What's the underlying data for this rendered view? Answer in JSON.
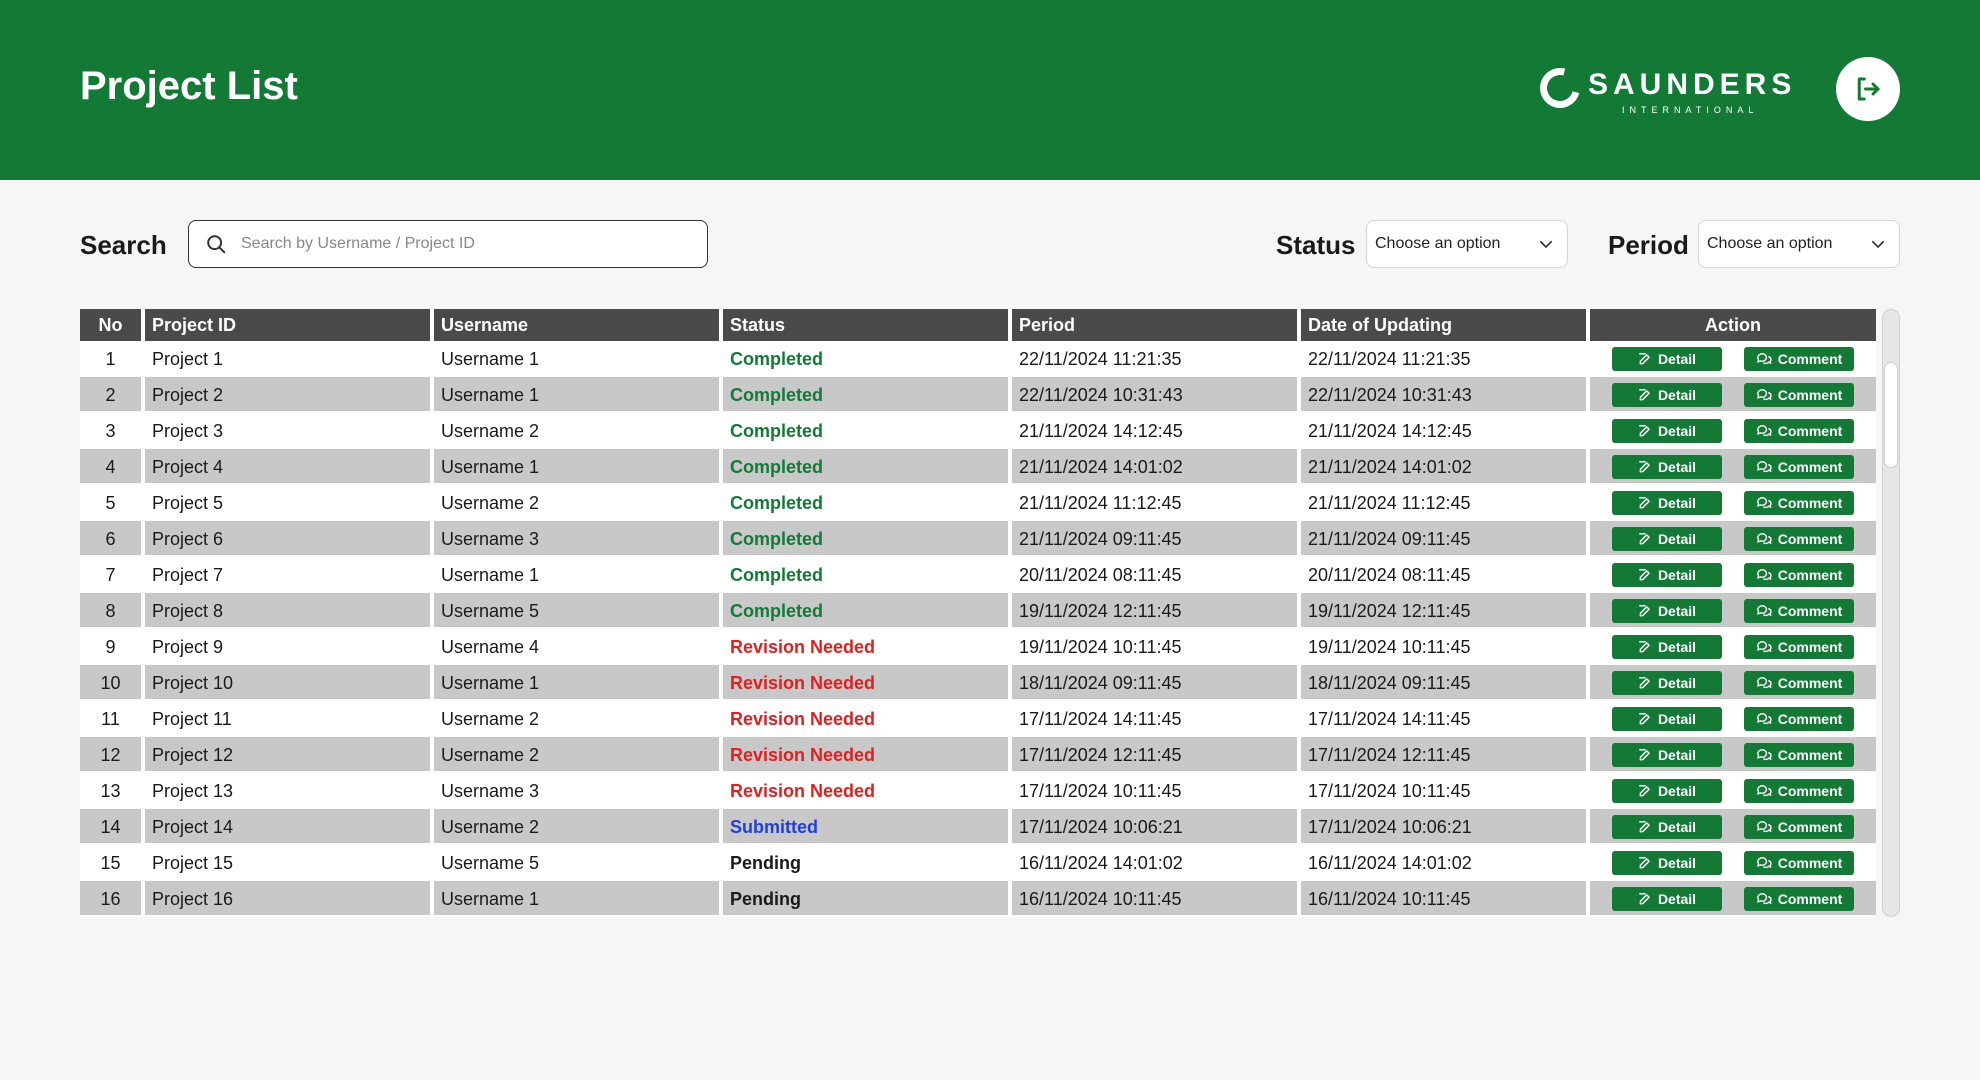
{
  "header": {
    "title": "Project List",
    "brand": "SAUNDERS",
    "brand_sub": "INTERNATIONAL",
    "logout_icon": "logout-icon",
    "color": "#137a36"
  },
  "filters": {
    "search_label": "Search",
    "search_placeholder": "Search by Username / Project ID",
    "search_value": "",
    "status_label": "Status",
    "status_value": "Choose an option",
    "period_label": "Period",
    "period_value": "Choose an option"
  },
  "table": {
    "columns": [
      "No",
      "Project ID",
      "Username",
      "Status",
      "Period",
      "Date of Updating",
      "Action"
    ],
    "detail_label": "Detail",
    "comment_label": "Comment",
    "rows": [
      {
        "no": "1",
        "project": "Project 1",
        "user": "Username 1",
        "status": "Completed",
        "period": "22/11/2024 11:21:35",
        "updated": "22/11/2024 11:21:35"
      },
      {
        "no": "2",
        "project": "Project 2",
        "user": "Username 1",
        "status": "Completed",
        "period": "22/11/2024 10:31:43",
        "updated": "22/11/2024 10:31:43"
      },
      {
        "no": "3",
        "project": "Project 3",
        "user": "Username 2",
        "status": "Completed",
        "period": "21/11/2024 14:12:45",
        "updated": "21/11/2024 14:12:45"
      },
      {
        "no": "4",
        "project": "Project 4",
        "user": "Username 1",
        "status": "Completed",
        "period": "21/11/2024 14:01:02",
        "updated": "21/11/2024 14:01:02"
      },
      {
        "no": "5",
        "project": "Project 5",
        "user": "Username 2",
        "status": "Completed",
        "period": "21/11/2024 11:12:45",
        "updated": "21/11/2024 11:12:45"
      },
      {
        "no": "6",
        "project": "Project 6",
        "user": "Username 3",
        "status": "Completed",
        "period": "21/11/2024 09:11:45",
        "updated": "21/11/2024 09:11:45"
      },
      {
        "no": "7",
        "project": "Project 7",
        "user": "Username 1",
        "status": "Completed",
        "period": "20/11/2024 08:11:45",
        "updated": "20/11/2024 08:11:45"
      },
      {
        "no": "8",
        "project": "Project 8",
        "user": "Username 5",
        "status": "Completed",
        "period": "19/11/2024 12:11:45",
        "updated": "19/11/2024 12:11:45"
      },
      {
        "no": "9",
        "project": "Project 9",
        "user": "Username 4",
        "status": "Revision Needed",
        "period": "19/11/2024 10:11:45",
        "updated": "19/11/2024 10:11:45"
      },
      {
        "no": "10",
        "project": "Project 10",
        "user": "Username 1",
        "status": "Revision Needed",
        "period": "18/11/2024 09:11:45",
        "updated": "18/11/2024 09:11:45"
      },
      {
        "no": "11",
        "project": "Project 11",
        "user": "Username 2",
        "status": "Revision Needed",
        "period": "17/11/2024 14:11:45",
        "updated": "17/11/2024 14:11:45"
      },
      {
        "no": "12",
        "project": "Project 12",
        "user": "Username 2",
        "status": "Revision Needed",
        "period": "17/11/2024 12:11:45",
        "updated": "17/11/2024 12:11:45"
      },
      {
        "no": "13",
        "project": "Project 13",
        "user": "Username 3",
        "status": "Revision Needed",
        "period": "17/11/2024 10:11:45",
        "updated": "17/11/2024 10:11:45"
      },
      {
        "no": "14",
        "project": "Project 14",
        "user": "Username 2",
        "status": "Submitted",
        "period": "17/11/2024 10:06:21",
        "updated": "17/11/2024 10:06:21"
      },
      {
        "no": "15",
        "project": "Project 15",
        "user": "Username 5",
        "status": "Pending",
        "period": "16/11/2024 14:01:02",
        "updated": "16/11/2024 14:01:02"
      },
      {
        "no": "16",
        "project": "Project 16",
        "user": "Username 1",
        "status": "Pending",
        "period": "16/11/2024 10:11:45",
        "updated": "16/11/2024 10:11:45"
      }
    ]
  },
  "status_colors": {
    "Completed": "#137a36",
    "Revision Needed": "#e02020",
    "Submitted": "#1f3fe0",
    "Pending": "#1a1a1a"
  }
}
